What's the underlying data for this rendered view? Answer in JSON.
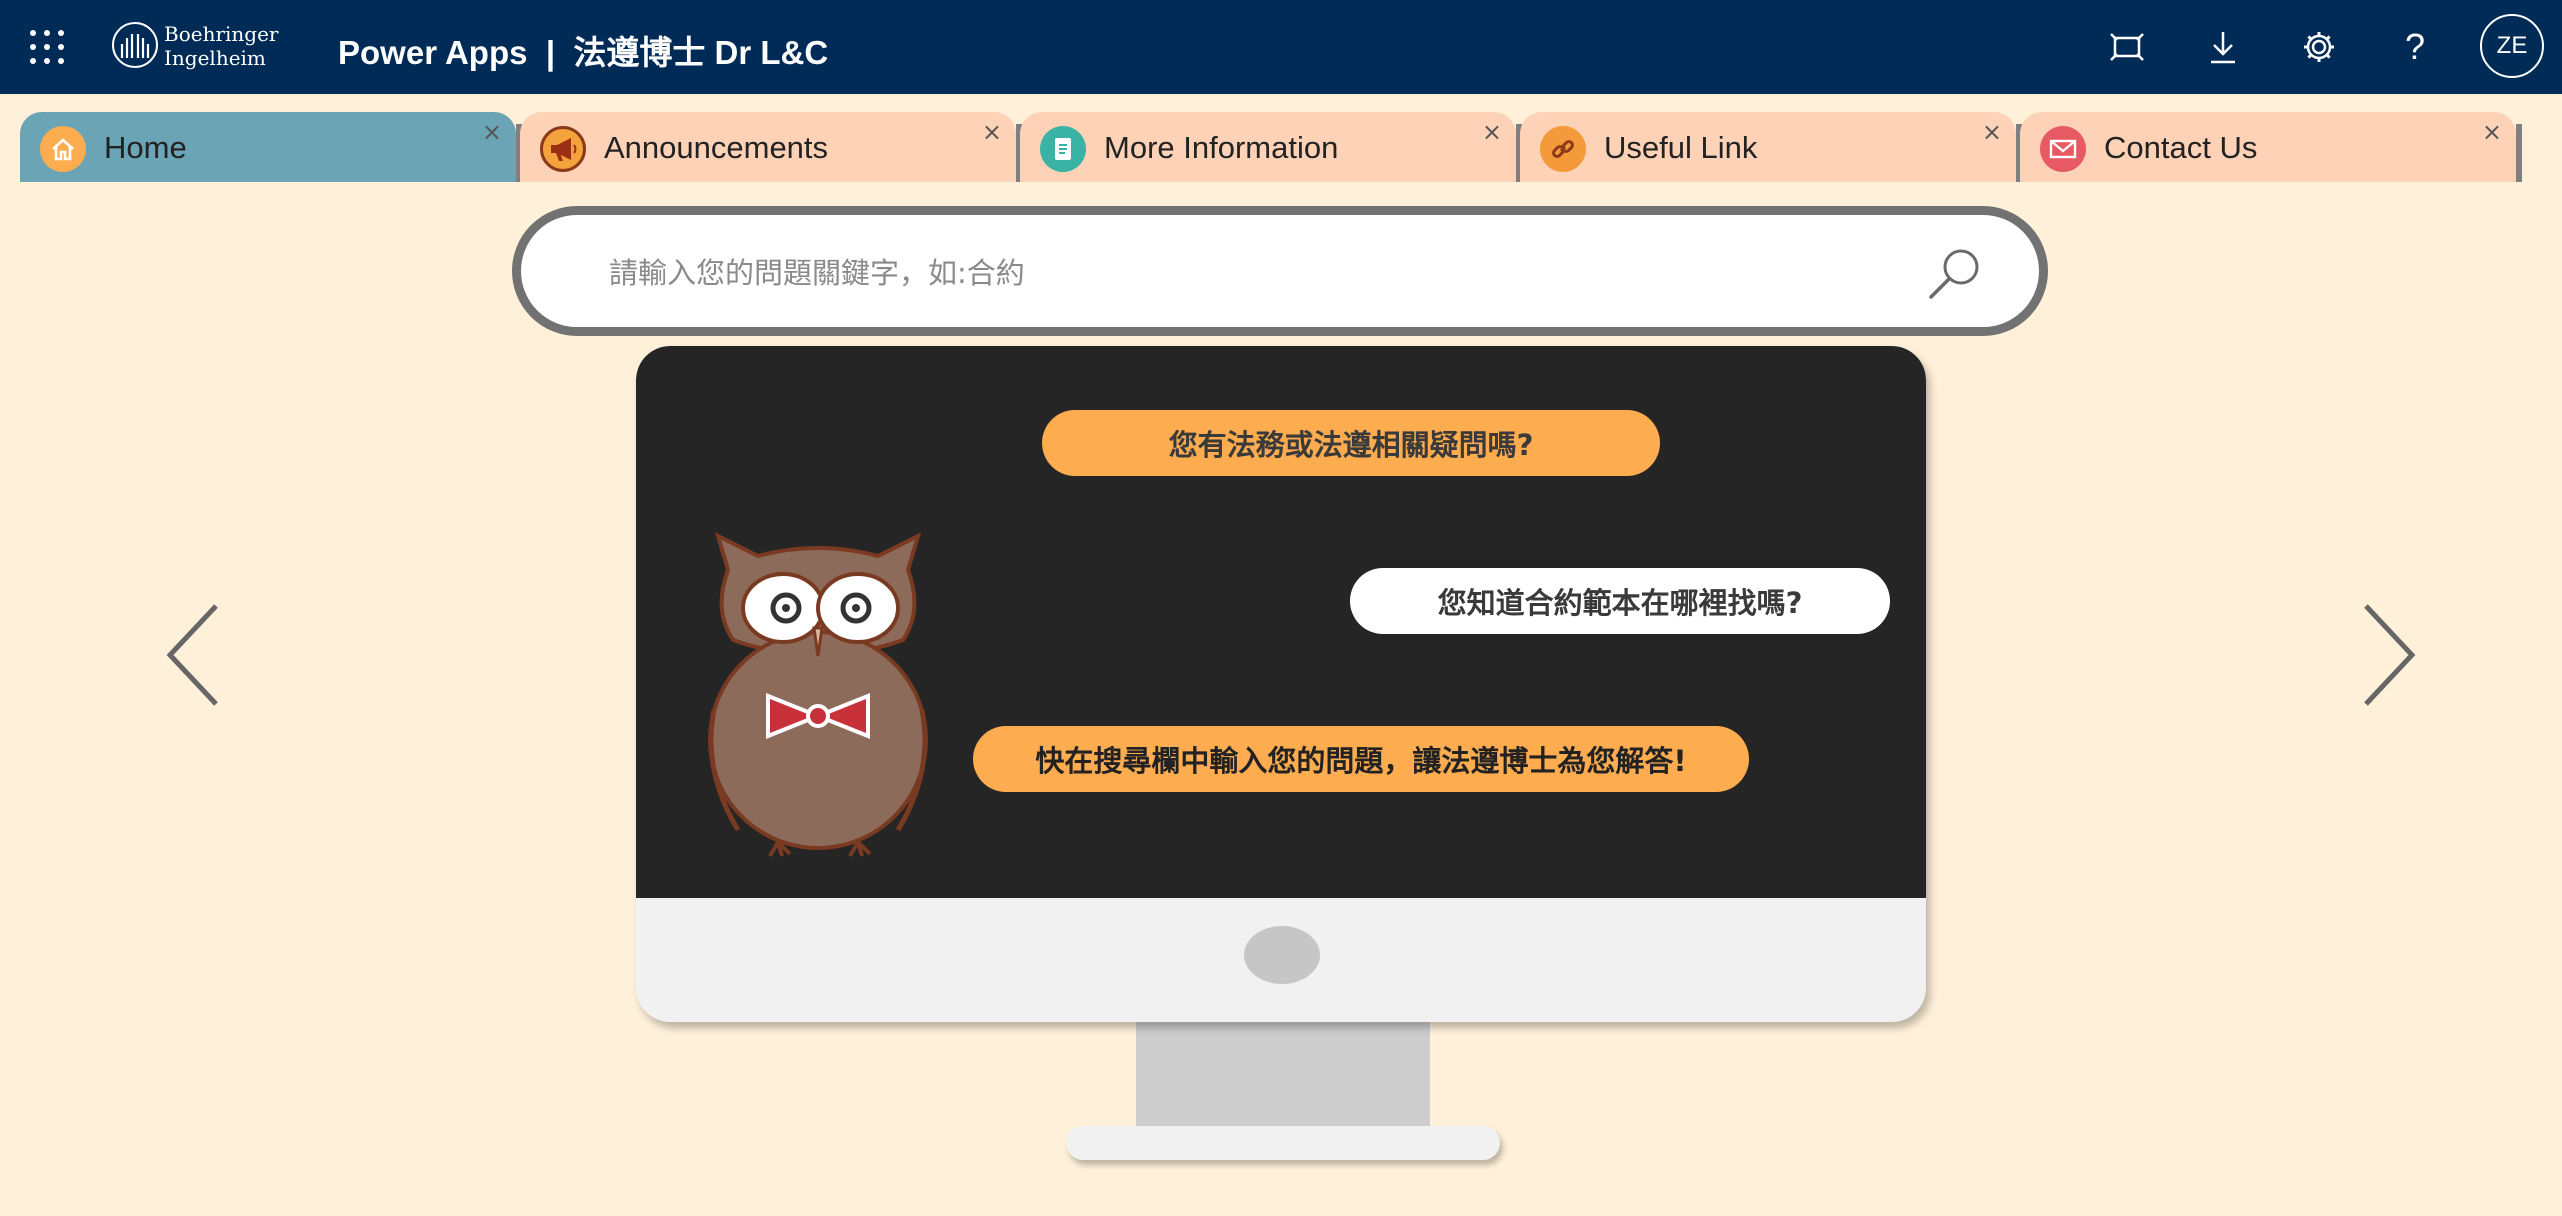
{
  "topbar": {
    "logo_line1": "Boehringer",
    "logo_line2": "Ingelheim",
    "app_title": "Power Apps  |  法遵博士 Dr L&C",
    "avatar_initials": "ZE",
    "icons": [
      "waffle-icon",
      "fit-to-screen-icon",
      "download-icon",
      "gear-icon",
      "help-icon"
    ],
    "help_glyph": "?"
  },
  "tabs": [
    {
      "label": "Home",
      "icon": "home-icon",
      "active": true,
      "close": "×"
    },
    {
      "label": "Announcements",
      "icon": "megaphone-icon",
      "active": false,
      "close": "×"
    },
    {
      "label": "More Information",
      "icon": "document-icon",
      "active": false,
      "close": "×"
    },
    {
      "label": "Useful Link",
      "icon": "link-icon",
      "active": false,
      "close": "×"
    },
    {
      "label": "Contact Us",
      "icon": "mail-icon",
      "active": false,
      "close": "×"
    }
  ],
  "search": {
    "placeholder": "請輸入您的問題關鍵字，如:合約",
    "value": ""
  },
  "carousel": {
    "bubble1": "您有法務或法遵相關疑問嗎?",
    "bubble2": "您知道合約範本在哪裡找嗎?",
    "bubble3": "快在搜尋欄中輸入您的問題，讓法遵博士為您解答!"
  },
  "colors": {
    "topbar": "#002b57",
    "page_bg": "#fef0d9",
    "tab_active": "#6ba4b5",
    "tab_inactive": "#fdd2b6",
    "bubble_orange": "#fdac4f",
    "screen": "#252525"
  }
}
